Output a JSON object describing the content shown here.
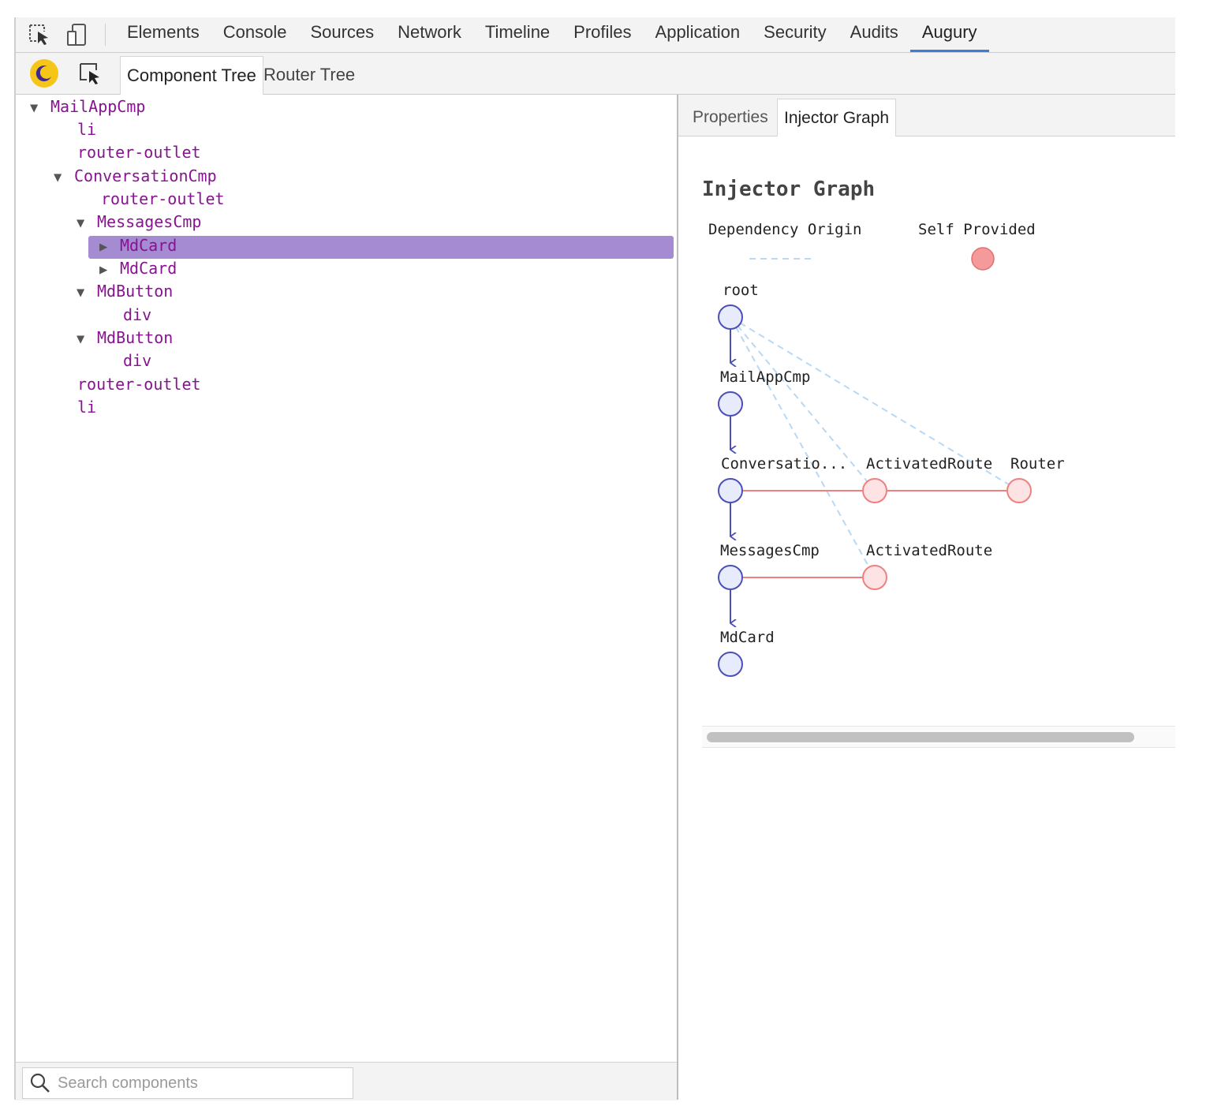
{
  "toolbar": {
    "inspect_icon": "inspect-element-icon",
    "device_icon": "device-mode-icon",
    "tabs": [
      "Elements",
      "Console",
      "Sources",
      "Network",
      "Timeline",
      "Profiles",
      "Application",
      "Security",
      "Audits",
      "Augury"
    ],
    "active_tab": "Augury"
  },
  "augury_toolbar": {
    "theme_icon": "moon-icon",
    "select_icon": "select-component-icon",
    "component_tree_tab": "Component Tree",
    "router_tree_tab": "Router Tree"
  },
  "tree": {
    "rows": [
      {
        "label": "MailAppCmp",
        "toggle": "▼"
      },
      {
        "label": "li",
        "toggle": ""
      },
      {
        "label": "router-outlet",
        "toggle": ""
      },
      {
        "label": "ConversationCmp",
        "toggle": "▼"
      },
      {
        "label": "router-outlet",
        "toggle": ""
      },
      {
        "label": "MessagesCmp",
        "toggle": "▼"
      },
      {
        "label": "MdCard",
        "toggle": "▶"
      },
      {
        "label": "MdCard",
        "toggle": "▶"
      },
      {
        "label": "MdButton",
        "toggle": "▼"
      },
      {
        "label": "div",
        "toggle": ""
      },
      {
        "label": "MdButton",
        "toggle": "▼"
      },
      {
        "label": "div",
        "toggle": ""
      },
      {
        "label": "router-outlet",
        "toggle": ""
      },
      {
        "label": "li",
        "toggle": ""
      }
    ],
    "selected_label": "MdCard",
    "colors": {
      "tag": "#881391",
      "selected_bg": "#a58bd1"
    }
  },
  "search": {
    "placeholder": "Search components",
    "value": ""
  },
  "details": {
    "properties_tab": "Properties",
    "injector_tab": "Injector Graph"
  },
  "injector_graph": {
    "title": "Injector Graph",
    "legend": {
      "dependency_origin": "Dependency Origin",
      "self_provided": "Self Provided"
    },
    "nodes": {
      "root": "root",
      "mailapp": "MailAppCmp",
      "conversation": "Conversatio...",
      "activated_route_1": "ActivatedRoute",
      "router": "Router",
      "messages": "MessagesCmp",
      "activated_route_2": "ActivatedRoute",
      "mdcard": "MdCard"
    },
    "colors": {
      "component_node": "#4b4fb8",
      "component_fill": "#e8ebfb",
      "provider_edge": "#f08080",
      "provider_fill": "#fde3e3",
      "dependency_edge": "#b8d8f5",
      "self_provided_fill": "#f59a9a"
    }
  }
}
